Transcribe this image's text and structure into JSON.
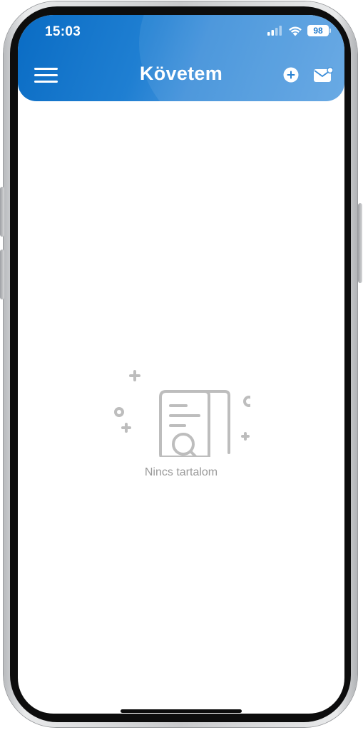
{
  "status_bar": {
    "time": "15:03",
    "battery": "98",
    "signal_icon": "cellular-signal-icon",
    "wifi_icon": "wifi-icon",
    "battery_icon": "battery-icon"
  },
  "header": {
    "title": "Követem",
    "menu_icon": "hamburger-menu-icon",
    "add_icon": "plus-circle-icon",
    "mail_icon": "envelope-icon"
  },
  "empty_state": {
    "message": "Nincs tartalom",
    "icon": "document-search-icon"
  },
  "colors": {
    "header_start": "#0a6cc4",
    "header_end": "#5da3e2",
    "empty_text": "#9a9a9a",
    "illustration": "#bdbdbd"
  }
}
